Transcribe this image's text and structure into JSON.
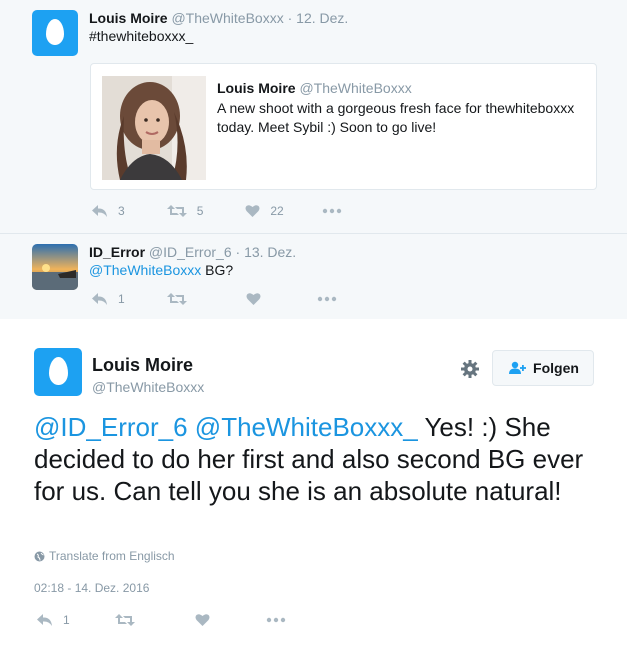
{
  "tweet1": {
    "name": "Louis Moire",
    "handle": "@TheWhiteBoxxx",
    "separator": "·",
    "date": "12. Dez.",
    "hashtag": "#thewhiteboxxx_",
    "quote": {
      "name": "Louis Moire",
      "handle": "@TheWhiteBoxxx",
      "text_line1": "A new shoot with a gorgeous fresh face for thewhiteboxxx",
      "text_line2": "today. Meet Sybil :) Soon to go live!"
    },
    "replies": "3",
    "retweets": "5",
    "likes": "22"
  },
  "tweet2": {
    "name": "ID_Error",
    "handle": "@ID_Error_6",
    "separator": "·",
    "date": "13. Dez.",
    "mention": "@TheWhiteBoxxx",
    "text": " BG?",
    "replies": "1"
  },
  "main": {
    "name": "Louis Moire",
    "handle": "@TheWhiteBoxxx",
    "follow_label": "Folgen",
    "mention1": "@ID_Error_6",
    "mention2": "@TheWhiteBoxxx_",
    "text_after": " Yes! :) She decided to do her first and also second BG ever for us. Can tell you she is an absolute natural!",
    "translate": "Translate from Englisch",
    "timestamp": "02:18 - 14. Dez. 2016",
    "replies": "1"
  },
  "colors": {
    "accent": "#1da1f2",
    "link": "#1b95e0",
    "muted": "#8899a6",
    "panel": "#f5f8fa"
  },
  "icons": [
    "reply-icon",
    "retweet-icon",
    "like-icon",
    "more-icon",
    "gear-icon",
    "follow-icon",
    "globe-icon"
  ]
}
